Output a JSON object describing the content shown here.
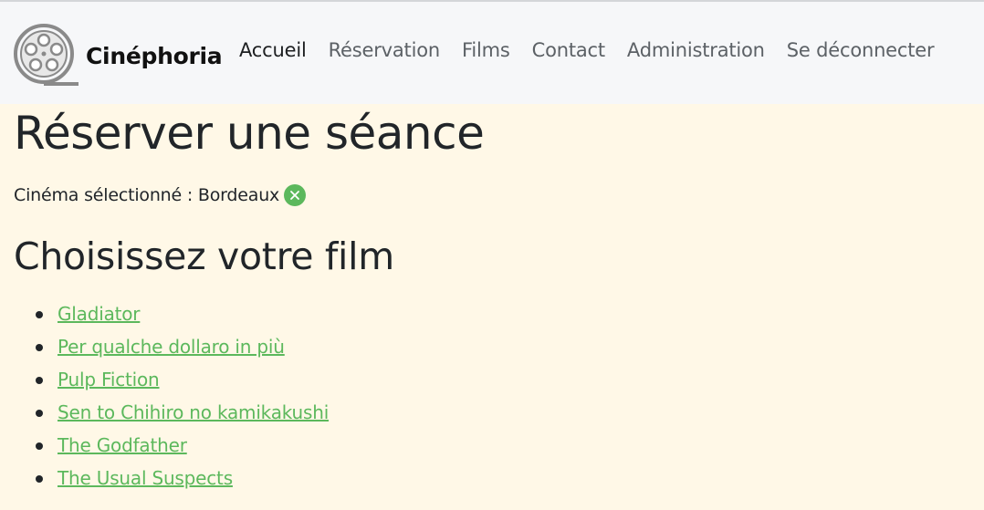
{
  "brand": {
    "name": "Cinéphoria",
    "logo_icon": "film-reel-icon"
  },
  "nav": {
    "items": [
      {
        "label": "Accueil",
        "active": true
      },
      {
        "label": "Réservation",
        "active": false
      },
      {
        "label": "Films",
        "active": false
      },
      {
        "label": "Contact",
        "active": false
      },
      {
        "label": "Administration",
        "active": false
      },
      {
        "label": "Se déconnecter",
        "active": false
      }
    ]
  },
  "page": {
    "title": "Réserver une séance",
    "selected_cinema_label": "Cinéma sélectionné : Bordeaux",
    "clear_icon": "close-circle-icon",
    "films_heading": "Choisissez votre film",
    "films": [
      "Gladiator",
      "Per qualche dollaro in più",
      "Pulp Fiction",
      "Sen to Chihiro no kamikakushi",
      "The Godfather",
      "The Usual Suspects"
    ]
  },
  "colors": {
    "background": "#fff8e7",
    "navbar": "#f6f7f9",
    "accent": "#5cb85c"
  }
}
